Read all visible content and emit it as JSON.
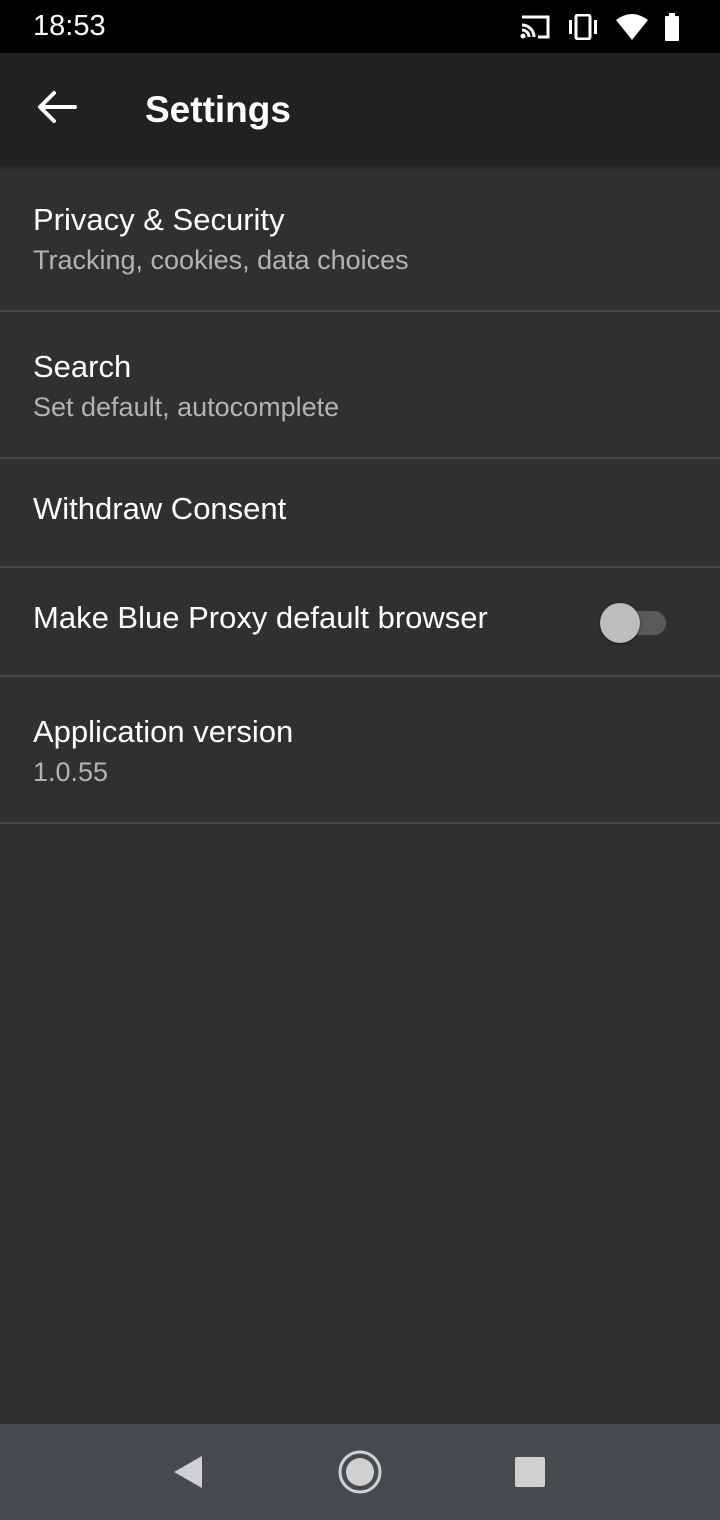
{
  "status_bar": {
    "time": "18:53",
    "icons": [
      "cast-icon",
      "vibrate-icon",
      "wifi-icon",
      "battery-icon"
    ]
  },
  "app_bar": {
    "title": "Settings",
    "back_icon": "arrow-back-icon"
  },
  "settings": {
    "items": [
      {
        "title": "Privacy & Security",
        "subtitle": "Tracking, cookies, data choices"
      },
      {
        "title": "Search",
        "subtitle": "Set default, autocomplete"
      },
      {
        "title": "Withdraw Consent"
      },
      {
        "title": "Make Blue Proxy default browser",
        "toggle_on": false
      },
      {
        "title": "Application version",
        "subtitle": "1.0.55"
      }
    ]
  },
  "nav_bar": {
    "icons": [
      "back-triangle-icon",
      "home-circle-icon",
      "recents-square-icon"
    ]
  },
  "colors": {
    "background": "#303030",
    "app_bar": "#212121",
    "status_bar": "#000000",
    "nav_bar": "#474b50",
    "divider": "#474747",
    "subtitle_text": "#b3b3b3"
  }
}
